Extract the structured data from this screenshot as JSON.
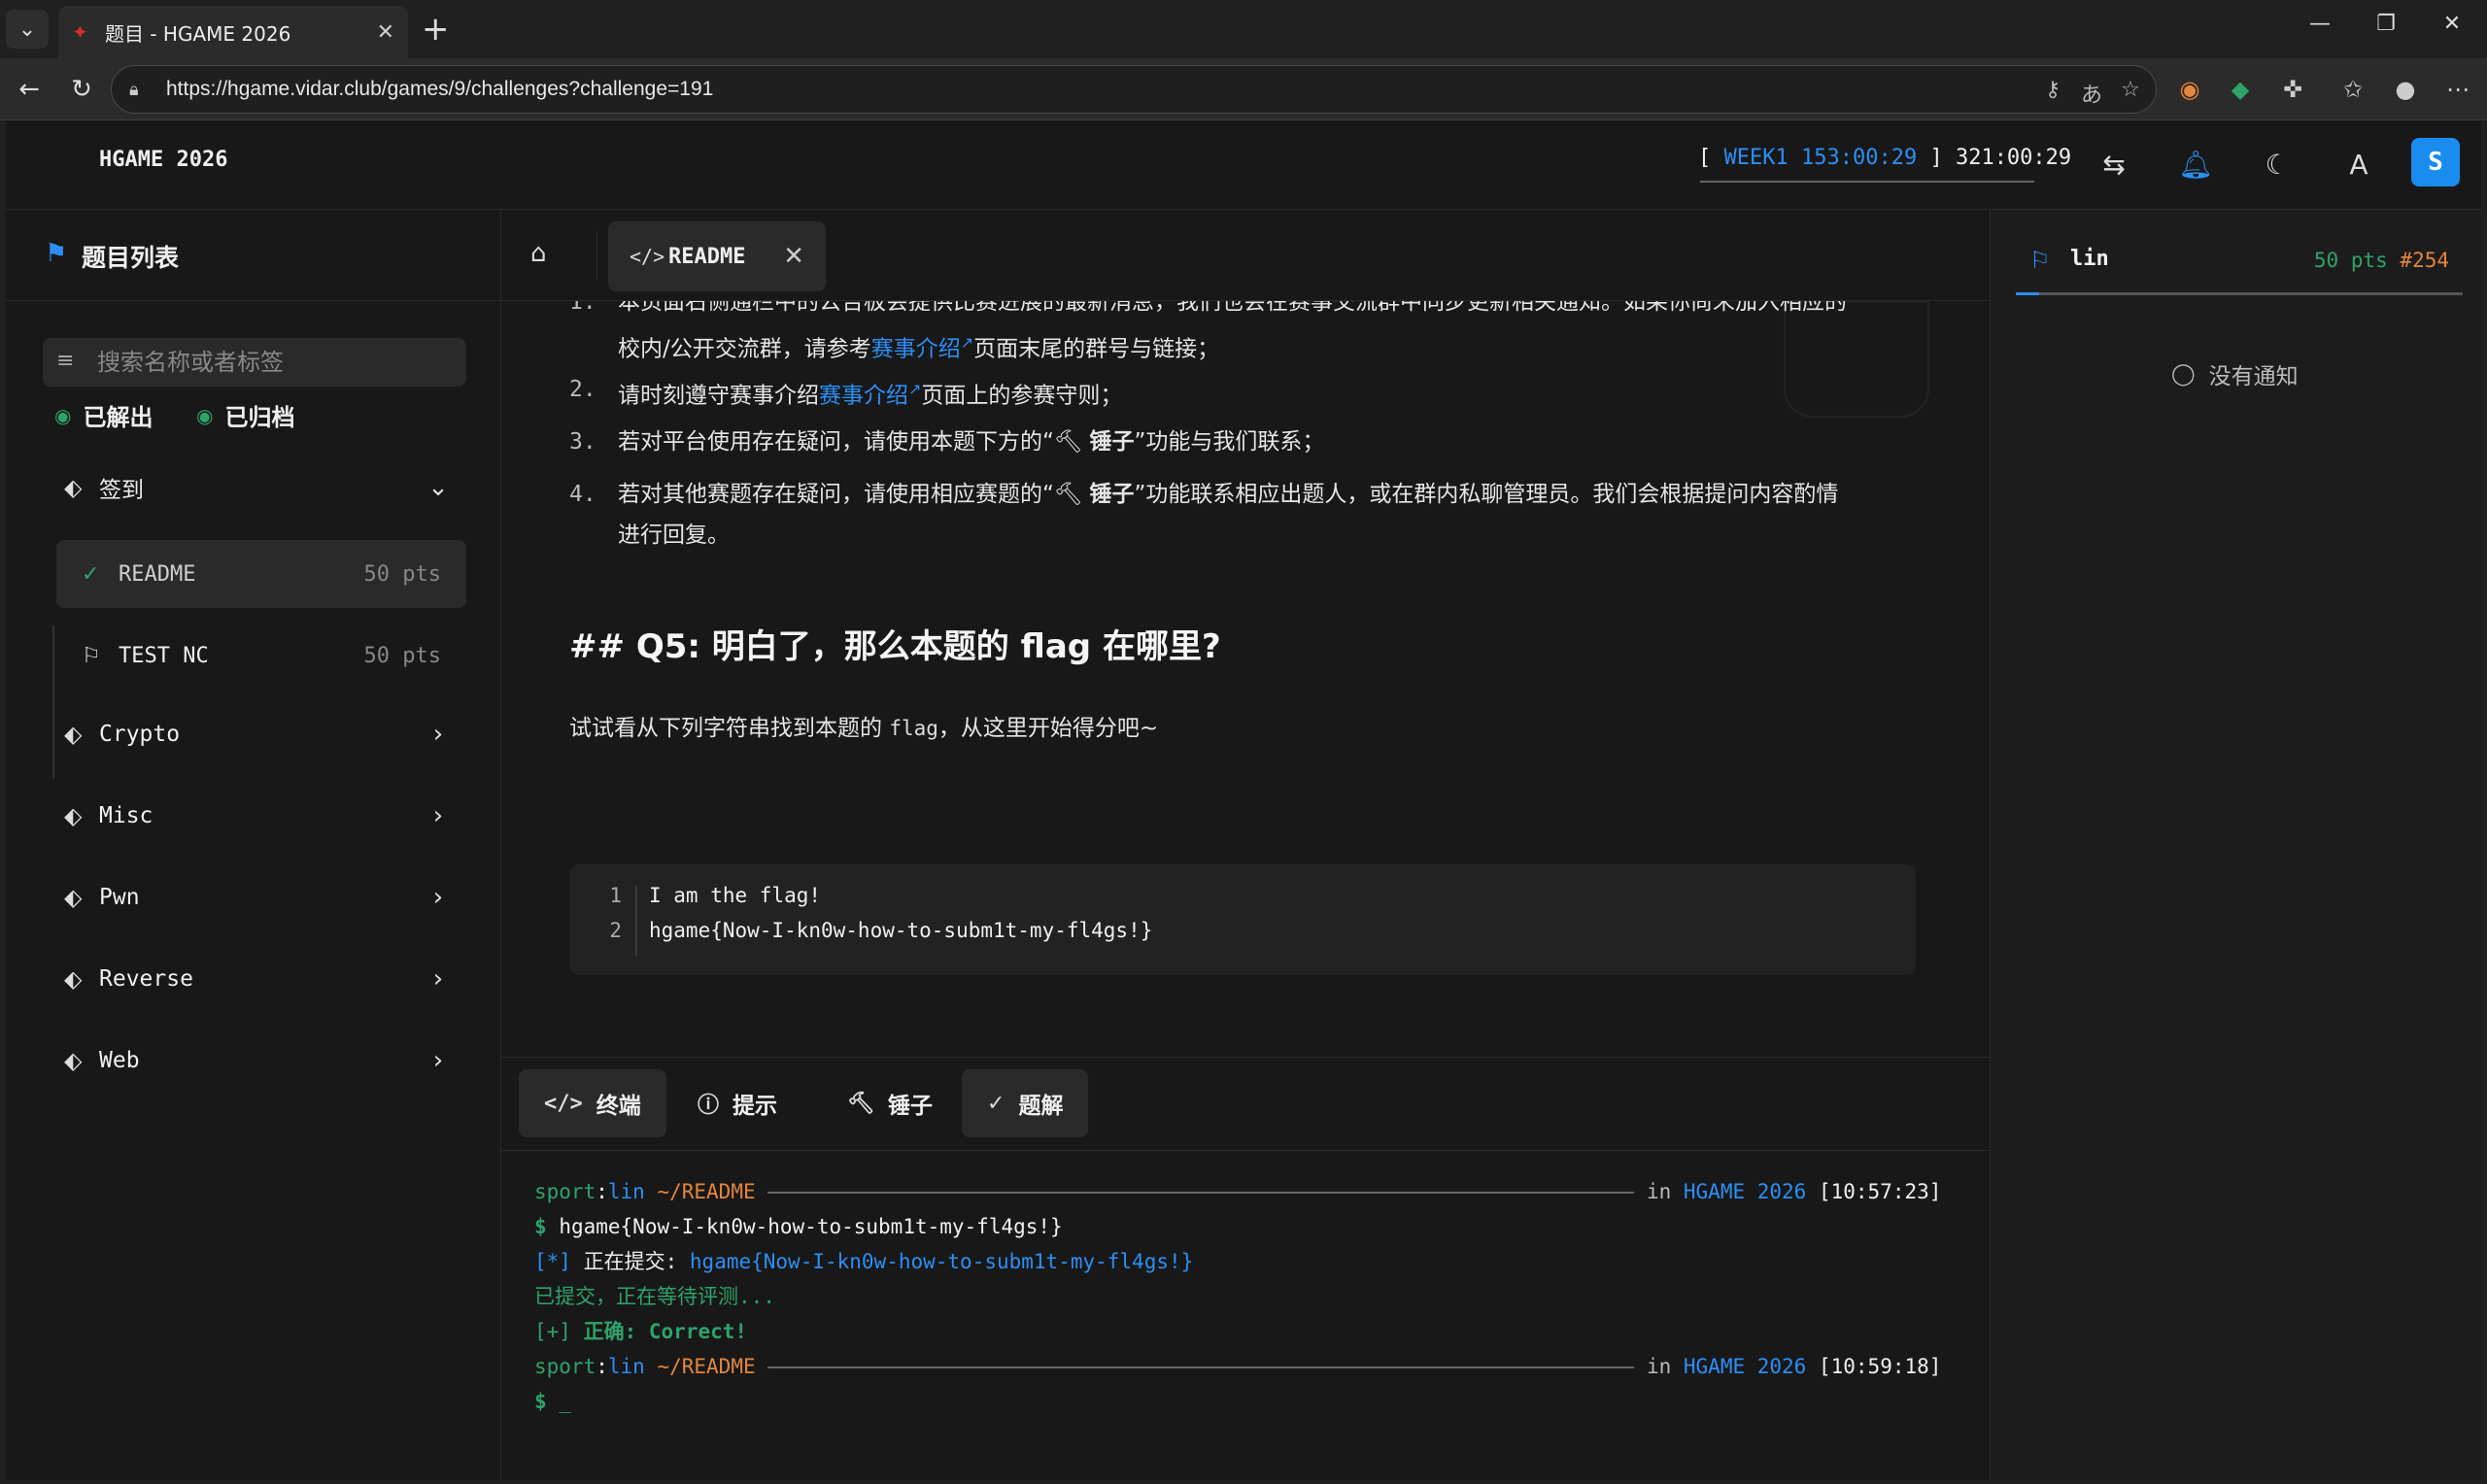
{
  "browser": {
    "tab_title": "题目 - HGAME 2026",
    "url": "https://hgame.vidar.club/games/9/challenges?challenge=191"
  },
  "header": {
    "app_title": "HGAME 2026",
    "timer_bracket_open": "[",
    "timer_week": "WEEK1",
    "timer_week_time": "153:00:29",
    "timer_bracket_close": "]",
    "timer_total": "321:00:29",
    "avatar_letter": "S"
  },
  "sidebar": {
    "title": "题目列表",
    "search_placeholder": "搜索名称或者标签",
    "filters": [
      "已解出",
      "已归档"
    ],
    "categories": [
      {
        "label": "签到",
        "expanded": true
      },
      {
        "label": "Crypto"
      },
      {
        "label": "Misc"
      },
      {
        "label": "Pwn"
      },
      {
        "label": "Reverse"
      },
      {
        "label": "Web"
      }
    ],
    "challenges": [
      {
        "name": "README",
        "pts": "50 pts",
        "solved": true,
        "active": true
      },
      {
        "name": "TEST NC",
        "pts": "50 pts",
        "solved": false
      }
    ]
  },
  "main": {
    "tab_label": "README",
    "rules": [
      {
        "num": "1.",
        "line1_cut": "本页面右侧通栏中的公告板会提供比赛进展的最新消息，我们也会在赛事交流群中同步更新相关通知。如果你尚未加入相应的",
        "line2_a": "校内/公开交流群，请参考",
        "line2_link": "赛事介绍",
        "line2_b": "页面末尾的群号与链接；"
      },
      {
        "num": "2.",
        "text_a": "请时刻遵守赛事介绍",
        "link": "赛事介绍",
        "text_b": "页面上的参赛守则；"
      },
      {
        "num": "3.",
        "text_a": "若对平台使用存在疑问，请使用本题下方的“",
        "bold": "锤子",
        "text_b": "”功能与我们联系；"
      },
      {
        "num": "4.",
        "text_a": "若对其他赛题存在疑问，请使用相应赛题的“",
        "bold": "锤子",
        "text_b": "”功能联系相应出题人，或在群内私聊管理员。我们会根据提问内容酌情",
        "line2": "进行回复。"
      }
    ],
    "q5_heading": "## Q5: 明白了，那么本题的 flag 在哪里?",
    "q5_desc_a": "试试看从下列字符串找到本题的 ",
    "q5_desc_code": "flag",
    "q5_desc_b": "，从这里开始得分吧~",
    "code_lines": [
      {
        "ln": "1",
        "src": "I am the flag!"
      },
      {
        "ln": "2",
        "src": "hgame{Now-I-kn0w-how-to-subm1t-my-fl4gs!}"
      }
    ]
  },
  "bottom": {
    "tabs": [
      "终端",
      "提示",
      "锤子",
      "题解"
    ],
    "terminal": {
      "user": "sport",
      "colon": ":",
      "name": "lin",
      "path": "~/README",
      "in": "in",
      "game": "HGAME 2026",
      "time1": "[10:57:23]",
      "time2": "[10:59:18]",
      "cmd": "hgame{Now-I-kn0w-how-to-subm1t-my-fl4gs!}",
      "submit_prefix": "[*]",
      "submit_label": "正在提交:",
      "submit_flag": "hgame{Now-I-kn0w-how-to-subm1t-my-fl4gs!}",
      "waiting": "已提交，正在等待评测...",
      "ok_prefix": "[+]",
      "ok_text": "正确: Correct!",
      "prompt": "$",
      "cursor": "_"
    }
  },
  "right": {
    "user_name": "lin",
    "score": "50 pts",
    "rank": "#254",
    "no_notice": "没有通知"
  },
  "colors": {
    "accent_blue": "#2b8ff5",
    "green": "#2ea36b",
    "orange": "#e3863b"
  }
}
